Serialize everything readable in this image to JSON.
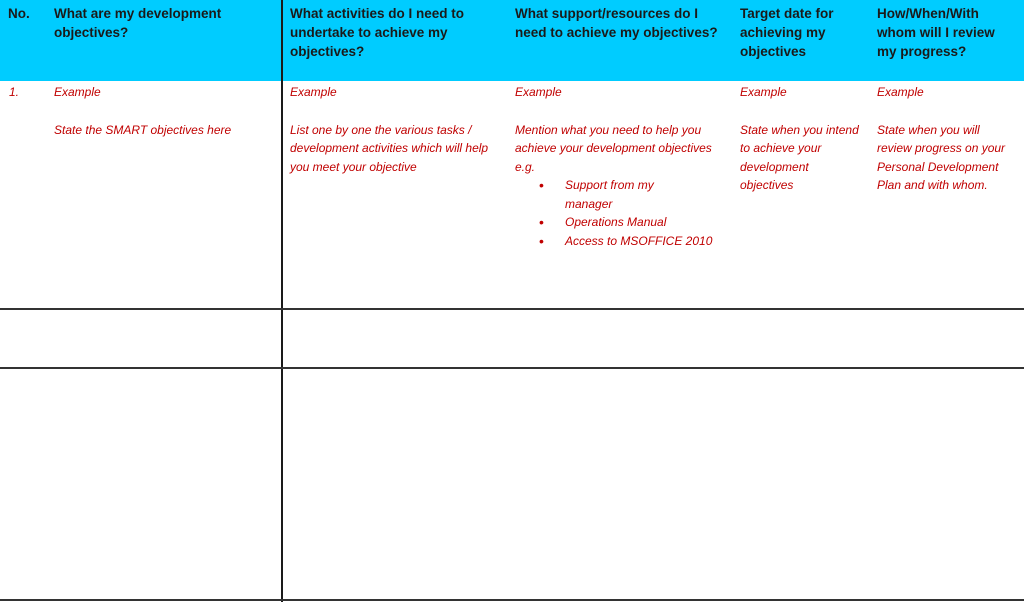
{
  "header": {
    "columns": [
      "No.",
      "What are my development objectives?",
      "What activities do I need to undertake to achieve my objectives?",
      "What support/resources do I need to achieve my objectives?",
      "Target date for achieving my objectives",
      "How/When/With whom will I review my progress?"
    ]
  },
  "rows": [
    {
      "no": "1.",
      "objectives": {
        "label": "Example",
        "text": "State the SMART objectives here"
      },
      "activities": {
        "label": "Example",
        "text": "List one by one the various tasks / development activities which will help you meet your objective"
      },
      "support": {
        "label": "Example",
        "text": "Mention what you need to help you achieve your development objectives e.g.",
        "bullets": [
          "Support from my manager",
          "Operations Manual",
          "Access to MSOFFICE 2010"
        ]
      },
      "target": {
        "label": "Example",
        "text": "State when you intend to achieve your development objectives"
      },
      "review": {
        "label": "Example",
        "text": "State when you will review progress on your Personal Development Plan and with whom."
      }
    }
  ],
  "colors": {
    "header_bg": "#00ccff",
    "example_text": "#c00000"
  }
}
